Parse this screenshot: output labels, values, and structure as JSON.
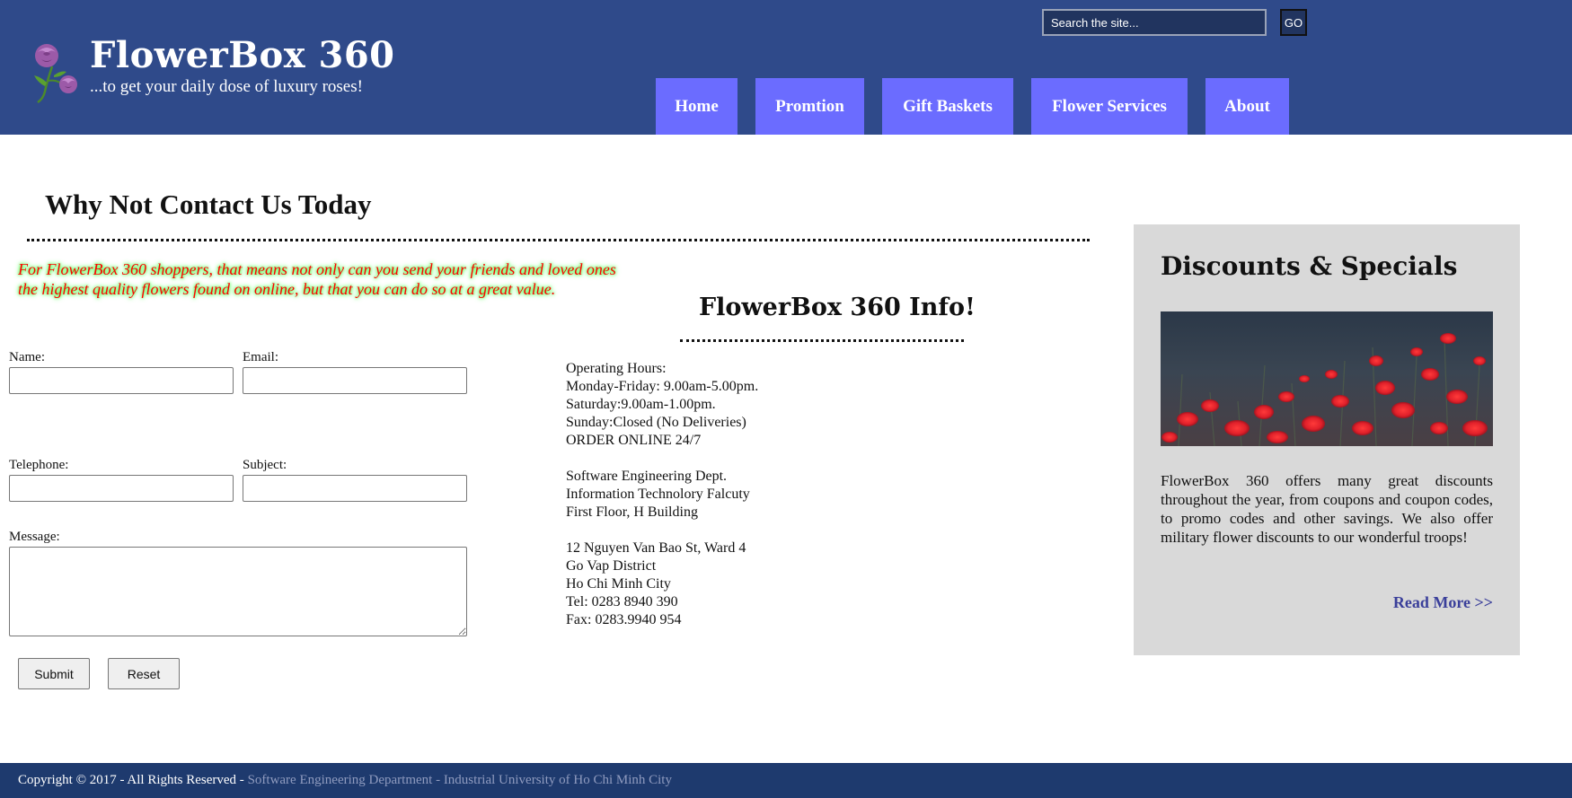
{
  "header": {
    "site_title": "FlowerBox 360",
    "tagline": "...to get your daily dose of luxury roses!",
    "search_placeholder": "Search the site...",
    "go_label": "GO",
    "nav": [
      {
        "label": "Home"
      },
      {
        "label": "Promtion"
      },
      {
        "label": "Gift Baskets"
      },
      {
        "label": "Flower Services"
      },
      {
        "label": "About"
      }
    ],
    "logo_icon": "rose-icon"
  },
  "contact": {
    "heading": "Why Not Contact Us Today",
    "intro_line1": "For FlowerBox 360 shoppers, that means not only can you send your friends and loved ones",
    "intro_line2": "the highest quality flowers found on online, but that you can do so at a great value.",
    "form": {
      "name_label": "Name:",
      "email_label": "Email:",
      "telephone_label": "Telephone:",
      "subject_label": "Subject:",
      "message_label": "Message:",
      "submit_label": "Submit",
      "reset_label": "Reset"
    }
  },
  "info": {
    "title": "FlowerBox 360 Info!",
    "lines": [
      "Operating Hours:",
      "Monday-Friday: 9.00am-5.00pm.",
      "Saturday:9.00am-1.00pm.",
      "Sunday:Closed (No Deliveries)",
      "ORDER ONLINE 24/7",
      "Software Engineering Dept.",
      "Information Technolory Falcuty",
      "First Floor, H Building",
      "12 Nguyen Van Bao St, Ward 4",
      "Go Vap District",
      "Ho Chi Minh City",
      "Tel: 0283 8940 390",
      "Fax: 0283.9940 954"
    ]
  },
  "sidebar": {
    "title": "Discounts & Specials",
    "image_subject": "red poppy field photo",
    "text": "FlowerBox 360 offers many great discounts throughout the year, from coupons and coupon codes, to promo codes and other savings. We also offer military flower discounts to our wonderful troops!",
    "read_more": "Read More >>"
  },
  "footer": {
    "copyright": "Copyright © 2017 - All Rights Reserved - ",
    "link_text": "Software Engineering Department - Industrial University of Ho Chi Minh City"
  },
  "colors": {
    "header_bg": "#2f4a8a",
    "nav_bg": "#6b6cff",
    "sidebar_bg": "#d9d9d9",
    "footer_bg": "#1e3a6e",
    "intro_text": "#ff0000",
    "read_more": "#3a3f9a"
  }
}
